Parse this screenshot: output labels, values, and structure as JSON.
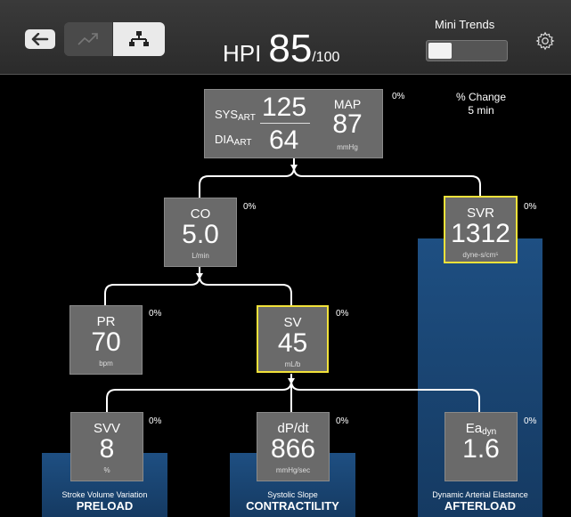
{
  "header": {
    "hpi_label": "HPI",
    "hpi_value": "85",
    "hpi_denominator": "/100",
    "mini_trends_label": "Mini Trends",
    "mini_trends_on": false
  },
  "change_label_line1": "% Change",
  "change_label_line2": "5 min",
  "art": {
    "sys_label": "SYS",
    "sys_sub": "ART",
    "dia_label": "DIA",
    "dia_sub": "ART",
    "sys_value": "125",
    "dia_value": "64",
    "map_label": "MAP",
    "map_value": "87",
    "map_unit": "mmHg",
    "pct": "0%"
  },
  "co": {
    "label": "CO",
    "value": "5.0",
    "unit": "L/min",
    "pct": "0%"
  },
  "svr": {
    "label": "SVR",
    "value": "1312",
    "unit": "dyne-s/cm⁵",
    "pct": "0%"
  },
  "pr": {
    "label": "PR",
    "value": "70",
    "unit": "bpm",
    "pct": "0%"
  },
  "sv": {
    "label": "SV",
    "value": "45",
    "unit": "mL/b",
    "pct": "0%"
  },
  "svv": {
    "label": "SVV",
    "value": "8",
    "unit": "%",
    "pct": "0%"
  },
  "dpdt": {
    "label": "dP/dt",
    "value": "866",
    "unit": "mmHg/sec",
    "pct": "0%"
  },
  "ea": {
    "label": "Ea",
    "label_sub": "dyn",
    "value": "1.6",
    "pct": "0%"
  },
  "footers": {
    "preload_desc": "Stroke Volume Variation",
    "preload": "PRELOAD",
    "contract_desc": "Systolic Slope",
    "contract": "CONTRACTILITY",
    "afterload_desc": "Dynamic Arterial Elastance",
    "afterload": "AFTERLOAD"
  },
  "colors": {
    "panel": "#1e4f82",
    "highlight": "#f2e23a",
    "box": "#6a6a6a"
  }
}
